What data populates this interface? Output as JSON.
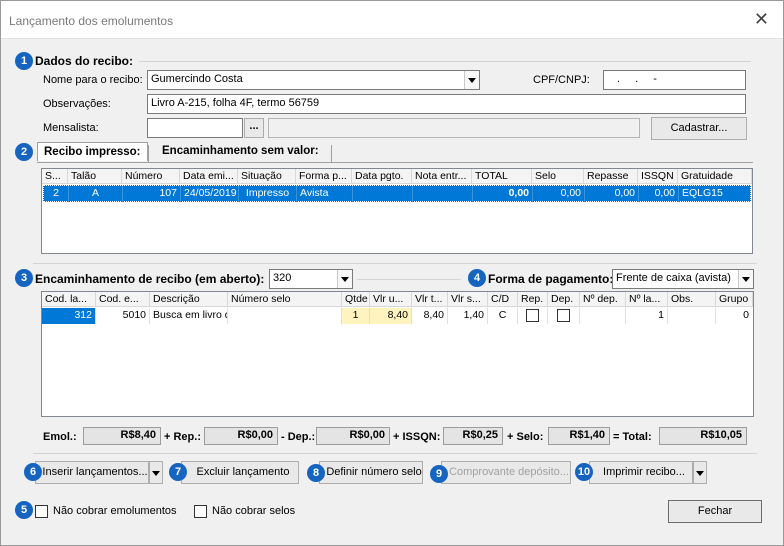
{
  "window": {
    "title": "Lançamento dos emolumentos",
    "close_glyph": "✕"
  },
  "badges": [
    "1",
    "2",
    "3",
    "4",
    "5",
    "6",
    "7",
    "8",
    "9",
    "10"
  ],
  "recibo": {
    "section_title": "Dados do recibo:",
    "nome_label": "Nome para o recibo:",
    "nome_value": "Gumercindo Costa",
    "cpf_label": "CPF/CNPJ:",
    "cpf_value": ". . -",
    "obs_label": "Observações:",
    "obs_value": "Livro A-215, folha 4F, termo 56759",
    "mensalista_label": "Mensalista:",
    "mensalista_btn": "...",
    "cadastrar_btn": "Cadastrar..."
  },
  "tabs": [
    {
      "label": "Recibo impresso:",
      "active": true
    },
    {
      "label": "Encaminhamento sem valor:",
      "active": false
    }
  ],
  "recibo_table": {
    "columns": [
      "S...",
      "Talão",
      "Número",
      "Data emi...",
      "Situação",
      "Forma p...",
      "Data pgto.",
      "Nota entr...",
      "TOTAL",
      "Selo",
      "Repasse",
      "ISSQN",
      "Gratuidade"
    ],
    "rows": [
      [
        "2",
        "A",
        "107",
        "24/05/2019",
        "Impresso",
        "Avista",
        "",
        "",
        "0,00",
        "0,00",
        "0,00",
        "0,00",
        "EQLG15"
      ]
    ]
  },
  "encaminhamento": {
    "label": "Encaminhamento de recibo (em aberto):",
    "value": "320",
    "forma_label": "Forma de pagamento:",
    "forma_value": "Frente de caixa (avista)"
  },
  "lanc_table": {
    "columns": [
      "Cod. la...",
      "Cod. e...",
      "Descrição",
      "Número selo",
      "Qtde",
      "Vlr u...",
      "Vlr t...",
      "Vlr s...",
      "C/D",
      "Rep.",
      "Dep.",
      "Nº dep.",
      "Nº la...",
      "Obs.",
      "Grupo"
    ],
    "rows": [
      [
        "312",
        "5010",
        "Busca em livro de",
        "",
        "1",
        "8,40",
        "8,40",
        "1,40",
        "C",
        "",
        "",
        "",
        "1",
        "",
        "0"
      ]
    ]
  },
  "totals": {
    "emol_label": "Emol.:",
    "emol": "R$8,40",
    "rep_label": "+ Rep.:",
    "rep": "R$0,00",
    "dep_label": "- Dep.:",
    "dep": "R$0,00",
    "issqn_label": "+ ISSQN:",
    "issqn": "R$0,25",
    "selo_label": "+ Selo:",
    "selo": "R$1,40",
    "total_label": "= Total:",
    "total": "R$10,05"
  },
  "actions": {
    "inserir": "Inserir lançamentos...",
    "excluir": "Excluir lançamento",
    "definir": "Definir número selo",
    "comprovante": "Comprovante depósito...",
    "imprimir": "Imprimir recibo..."
  },
  "footer": {
    "nao_emol": "Não cobrar emolumentos",
    "nao_selos": "Não cobrar selos",
    "fechar": "Fechar"
  },
  "colors": {
    "selection": "#0078d7",
    "badge": "#1565c0",
    "highlight_cell": "#fff3c0"
  }
}
